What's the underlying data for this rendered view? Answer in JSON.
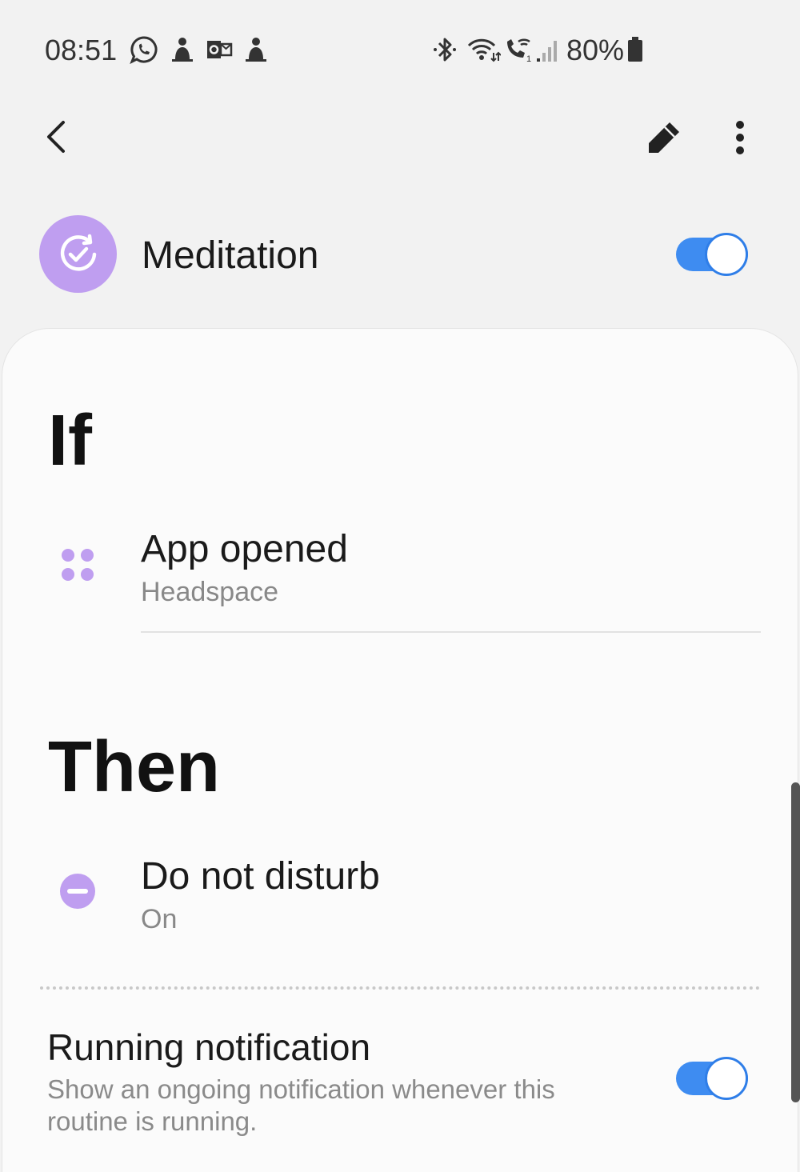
{
  "status_bar": {
    "time": "08:51",
    "notification_icons": [
      "whatsapp-icon",
      "headspace-app-icon",
      "outlook-icon",
      "headspace-app-icon"
    ],
    "system_icons": [
      "bluetooth-icon",
      "wifi-icon",
      "wifi-calling-icon",
      "signal-icon",
      "battery-icon"
    ],
    "battery": "80%"
  },
  "toolbar": {
    "back_icon": "back-arrow-icon",
    "edit_icon": "pencil-icon",
    "more_icon": "more-vertical-icon"
  },
  "routine": {
    "title": "Meditation",
    "icon": "routine-check-icon",
    "enabled": true,
    "accent_color": "#bf9ef0",
    "toggle_color": "#3e8cf1"
  },
  "if_section": {
    "title": "If",
    "condition": {
      "icon": "app-grid-icon",
      "title": "App opened",
      "subtitle": "Headspace"
    }
  },
  "then_section": {
    "title": "Then",
    "action": {
      "icon": "do-not-disturb-icon",
      "title": "Do not disturb",
      "subtitle": "On"
    }
  },
  "running_notification": {
    "title": "Running notification",
    "description": "Show an ongoing notification whenever this routine is running.",
    "enabled": true
  }
}
